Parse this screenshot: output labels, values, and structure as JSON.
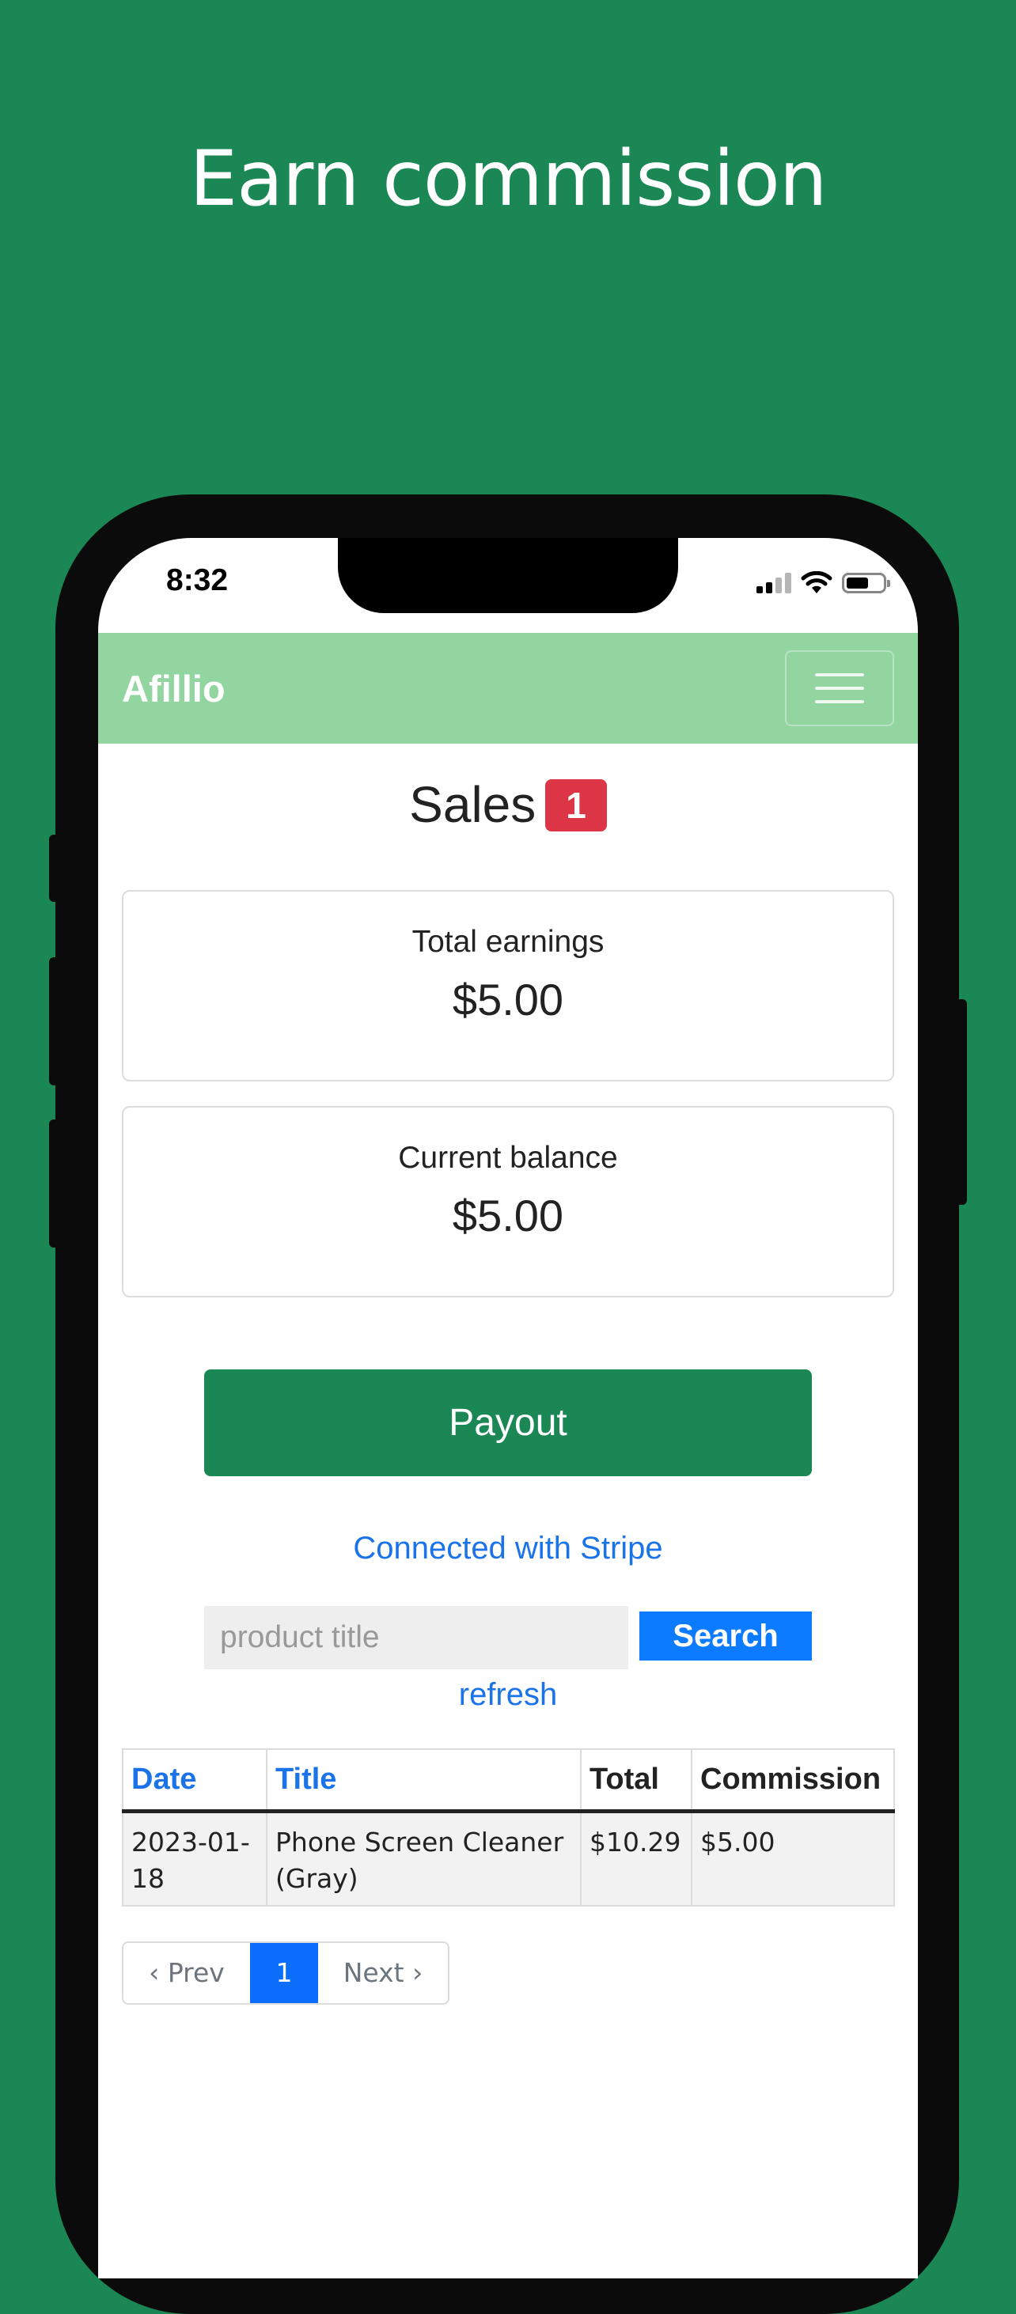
{
  "headline": "Earn commission",
  "status_bar": {
    "time": "8:32"
  },
  "navbar": {
    "brand": "Afillio"
  },
  "sales": {
    "title": "Sales",
    "badge_count": "1"
  },
  "cards": [
    {
      "label": "Total earnings",
      "amount": "$5.00"
    },
    {
      "label": "Current balance",
      "amount": "$5.00"
    }
  ],
  "payout_label": "Payout",
  "stripe_link": "Connected with Stripe",
  "search": {
    "placeholder": "product title",
    "button_label": "Search"
  },
  "refresh_link": "refresh",
  "table": {
    "headers": [
      "Date",
      "Title",
      "Total",
      "Commission"
    ],
    "rows": [
      {
        "date": "2023-01-18",
        "title": "Phone Screen Cleaner (Gray)",
        "total": "$10.29",
        "commission": "$5.00"
      }
    ]
  },
  "pagination": {
    "prev": "‹ Prev",
    "current": "1",
    "next": "Next ›"
  },
  "colors": {
    "background": "#1a8754",
    "navbar": "#92d5a1",
    "badge": "#dc3545",
    "link": "#1a73e8",
    "search_button": "#0d7bff"
  },
  "icons": [
    "signal-icon",
    "wifi-icon",
    "battery-icon",
    "hamburger-menu-icon"
  ]
}
